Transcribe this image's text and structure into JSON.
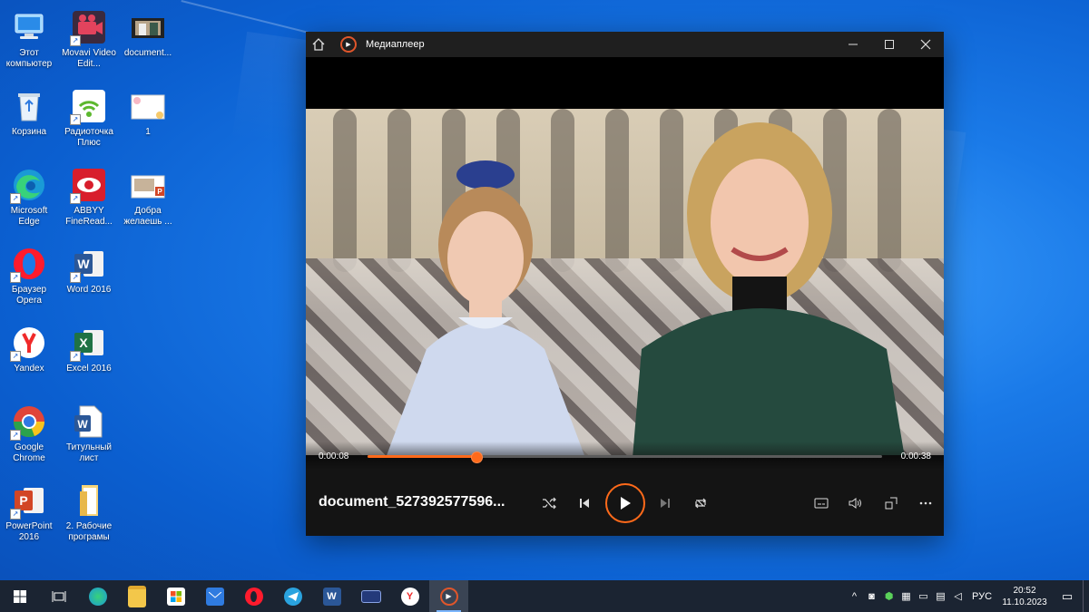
{
  "desktop": {
    "icons": [
      {
        "label": "Этот компьютер",
        "icon": "computer-icon"
      },
      {
        "label": "Movavi Video Edit...",
        "icon": "movavi-icon"
      },
      {
        "label": "document...",
        "icon": "video-file-icon"
      },
      {
        "label": "Корзина",
        "icon": "recycle-bin-icon"
      },
      {
        "label": "Радиоточка Плюс",
        "icon": "radio-icon"
      },
      {
        "label": "1",
        "icon": "image-file-icon"
      },
      {
        "label": "Microsoft Edge",
        "icon": "edge-icon"
      },
      {
        "label": "ABBYY FineRead...",
        "icon": "abbyy-icon"
      },
      {
        "label": "Добра желаешь ...",
        "icon": "powerpoint-file-icon"
      },
      {
        "label": "Браузер Opera",
        "icon": "opera-icon"
      },
      {
        "label": "Word 2016",
        "icon": "word-icon"
      },
      {
        "label": "Yandex",
        "icon": "yandex-icon"
      },
      {
        "label": "Excel 2016",
        "icon": "excel-icon"
      },
      {
        "label": "Google Chrome",
        "icon": "chrome-icon"
      },
      {
        "label": "Титульный лист",
        "icon": "word-file-icon"
      },
      {
        "label": "PowerPoint 2016",
        "icon": "powerpoint-icon"
      },
      {
        "label": "2. Рабочие програмы",
        "icon": "folder-icon"
      }
    ]
  },
  "player": {
    "title": "Медиаплеер",
    "file_name": "document_527392577596...",
    "current_time": "0:00:08",
    "total_time": "0:00:38",
    "progress": 0.2105,
    "accent": "#ff6a1a"
  },
  "taskbar": {
    "apps": [
      "start-icon",
      "task-view-icon",
      "edge-icon",
      "file-explorer-icon",
      "store-icon",
      "mail-icon",
      "opera-icon",
      "telegram-icon",
      "word-icon",
      "display-icon",
      "yandex-icon",
      "media-player-icon"
    ],
    "language": "РУС",
    "time": "20:52",
    "date": "11.10.2023"
  }
}
